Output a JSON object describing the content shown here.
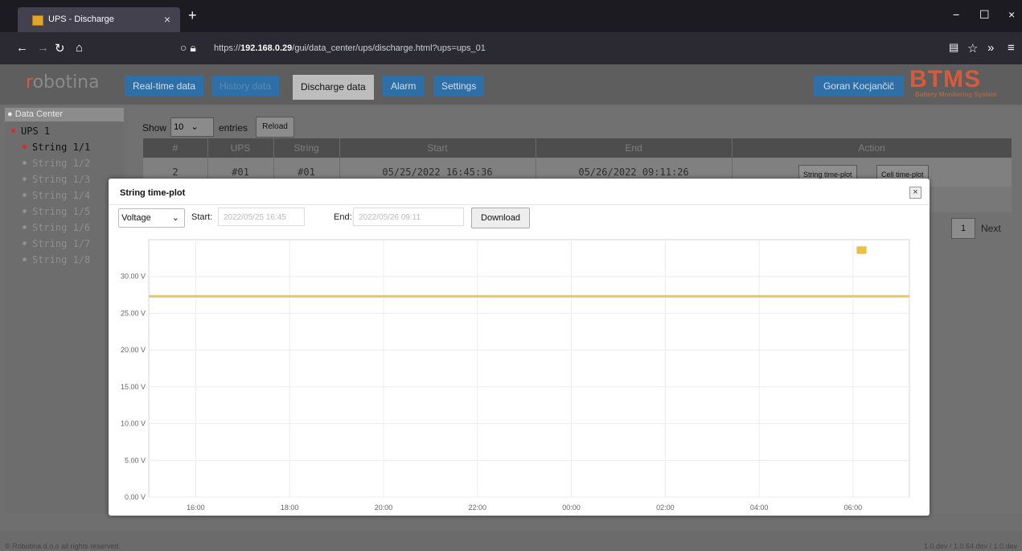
{
  "browser": {
    "tab_title": "UPS - Discharge",
    "tab_close": "×",
    "new_tab": "+",
    "url_prefix": "https://",
    "url_host": "192.168.0.29",
    "url_path": "/gui/data_center/ups/discharge.html?ups=ups_01"
  },
  "header": {
    "logo_r": "r",
    "logo_text": "obotina",
    "menu": [
      "Real-time data",
      "History data",
      "Discharge data",
      "Alarm",
      "Settings"
    ],
    "user": "Goran Kocjančič",
    "brand": "BTMS",
    "brand_sub": "Battery Monitoring System"
  },
  "sidebar": {
    "head": "Data Center",
    "ups": "UPS 1",
    "strings": [
      "String 1/1",
      "String 1/2",
      "String 1/3",
      "String 1/4",
      "String 1/5",
      "String 1/6",
      "String 1/7",
      "String 1/8"
    ]
  },
  "table": {
    "show": "Show",
    "entries_value": "10",
    "entries": "entries",
    "reload": "Reload",
    "columns": [
      "#",
      "UPS",
      "String",
      "Start",
      "End",
      "Action"
    ],
    "row": {
      "n": "2",
      "ups": "#01",
      "string": "#01",
      "start": "05/25/2022 16:45:36",
      "end": "05/26/2022 09:11:26"
    },
    "action_string": "String time-plot",
    "action_cell": "Cell time-plot",
    "page": "1",
    "next": "Next"
  },
  "footer": {
    "left": "© Robotina d.o.o all rights reserved.",
    "right": "1.0.dev / 1.0.64.dev / 1.0.dev"
  },
  "modal": {
    "title": "String time-plot",
    "close": "×",
    "measure": "Voltage",
    "start_label": "Start:",
    "start_value": "2022/05/25 16:45",
    "end_label": "End:",
    "end_value": "2022/05/26 09:11",
    "download": "Download"
  },
  "chart_data": {
    "type": "line",
    "x_ticks": [
      "16:00",
      "18:00",
      "20:00",
      "22:00",
      "00:00",
      "02:00",
      "04:00",
      "06:00"
    ],
    "y_ticks": [
      "0.00 V",
      "5.00 V",
      "10.00 V",
      "15.00 V",
      "20.00 V",
      "25.00 V",
      "30.00 V"
    ],
    "ylim": [
      0,
      35
    ],
    "x_range_hours": [
      15.0,
      31.2
    ],
    "series": [
      {
        "color": "#e2c77a",
        "legend_color": "#edc240",
        "x": [
          15.0,
          31.2
        ],
        "y": [
          27.3,
          27.3
        ]
      }
    ],
    "grid": true,
    "legend": "top-right"
  }
}
